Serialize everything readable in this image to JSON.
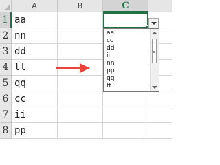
{
  "columns": [
    "A",
    "B",
    "C"
  ],
  "rows": [
    "1",
    "2",
    "3",
    "4",
    "5",
    "6",
    "7",
    "8"
  ],
  "column_a_values": [
    "aa",
    "nn",
    "dd",
    "tt",
    "qq",
    "cc",
    "ii",
    "pp"
  ],
  "selected_cell": {
    "column": "C",
    "row": "1",
    "value": ""
  },
  "dropdown": {
    "items": [
      "aa",
      "cc",
      "dd",
      "ii",
      "nn",
      "pp",
      "qq",
      "tt"
    ]
  },
  "colors": {
    "selection": "#217346",
    "arrow": "#e8443a"
  },
  "icons": {
    "dropdown": "chevron-down-icon",
    "annotation": "right-arrow-icon"
  }
}
